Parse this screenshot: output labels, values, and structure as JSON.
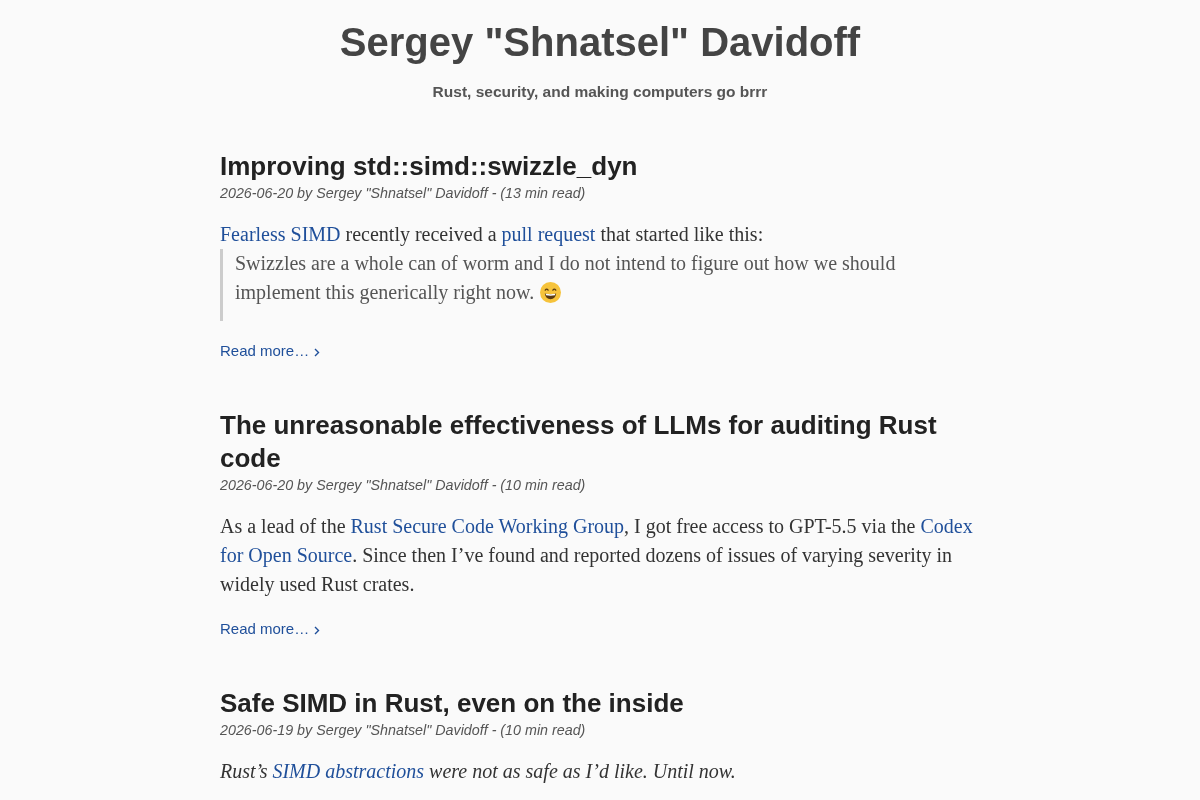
{
  "site": {
    "title": "Sergey \"Shnatsel\" Davidoff",
    "tagline": "Rust, security, and making computers go brrr"
  },
  "posts": [
    {
      "title": "Improving std::simd::swizzle_dyn",
      "meta": "2026-06-20 by Sergey \"Shnatsel\" Davidoff - (13 min read)",
      "excerpt": {
        "italic": false,
        "segments": [
          {
            "kind": "link",
            "lines": [
              "Fearless SIMD"
            ]
          },
          {
            "kind": "text",
            "text": " recently received a "
          },
          {
            "kind": "link",
            "lines": [
              "pull request"
            ]
          },
          {
            "kind": "text",
            "text": " that started like this:"
          }
        ]
      },
      "quote": {
        "lines": [
          "Swizzles are a whole can of worm and I do not intend to figure out how we should",
          "implement this generically right now."
        ],
        "emoji": true
      },
      "read_more": "Read more…"
    },
    {
      "title": "The unreasonable effectiveness of LLMs for auditing Rust code",
      "meta": "2026-06-20 by Sergey \"Shnatsel\" Davidoff - (10 min read)",
      "excerpt": {
        "italic": false,
        "segments": [
          {
            "kind": "text",
            "text": "As a lead of the "
          },
          {
            "kind": "link",
            "lines": [
              "Rust Secure Code Working Group"
            ]
          },
          {
            "kind": "text",
            "text": ", I got free access to GPT-5.5 via the "
          },
          {
            "kind": "link",
            "lines": [
              "Codex",
              "for Open Source"
            ]
          },
          {
            "kind": "text",
            "text": ". Since then I’ve found and reported dozens of issues of varying severity in widely used Rust crates."
          }
        ]
      },
      "read_more": "Read more…"
    },
    {
      "title": "Safe SIMD in Rust, even on the inside",
      "meta": "2026-06-19 by Sergey \"Shnatsel\" Davidoff - (10 min read)",
      "excerpt": {
        "italic": true,
        "segments": [
          {
            "kind": "text",
            "text": "Rust’s "
          },
          {
            "kind": "link",
            "lines": [
              "SIMD abstractions"
            ]
          },
          {
            "kind": "text",
            "text": " were not as safe as I’d like. Until now."
          }
        ]
      }
    }
  ]
}
